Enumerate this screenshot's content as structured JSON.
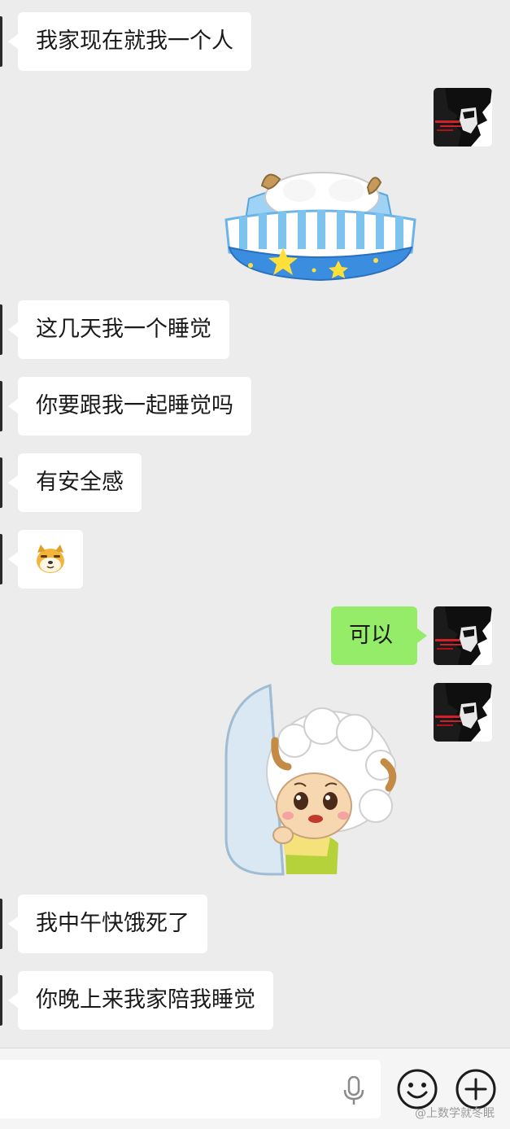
{
  "messages": {
    "m1": "我家现在就我一个人",
    "m2": "这几天我一个睡觉",
    "m3": "你要跟我一起睡觉吗",
    "m4": "有安全感",
    "m5": "可以",
    "m6": "我中午快饿死了",
    "m7": "你晚上来我家陪我睡觉"
  },
  "stickers": {
    "s1": "sheep-sleeping-in-bed-sticker",
    "s2": "lazy-sheep-peeking-from-door-sticker",
    "emoji": "dog-face-emoji"
  },
  "input": {
    "value": ""
  },
  "icons": {
    "voice": "microphone-icon",
    "emoji": "smiley-face-icon",
    "more": "plus-circle-icon"
  },
  "watermark": "@上数学就冬眠",
  "colors": {
    "chat_background": "#ececec",
    "incoming_bubble": "#ffffff",
    "outgoing_bubble": "#95ec69",
    "input_bar": "#f5f5f5"
  }
}
